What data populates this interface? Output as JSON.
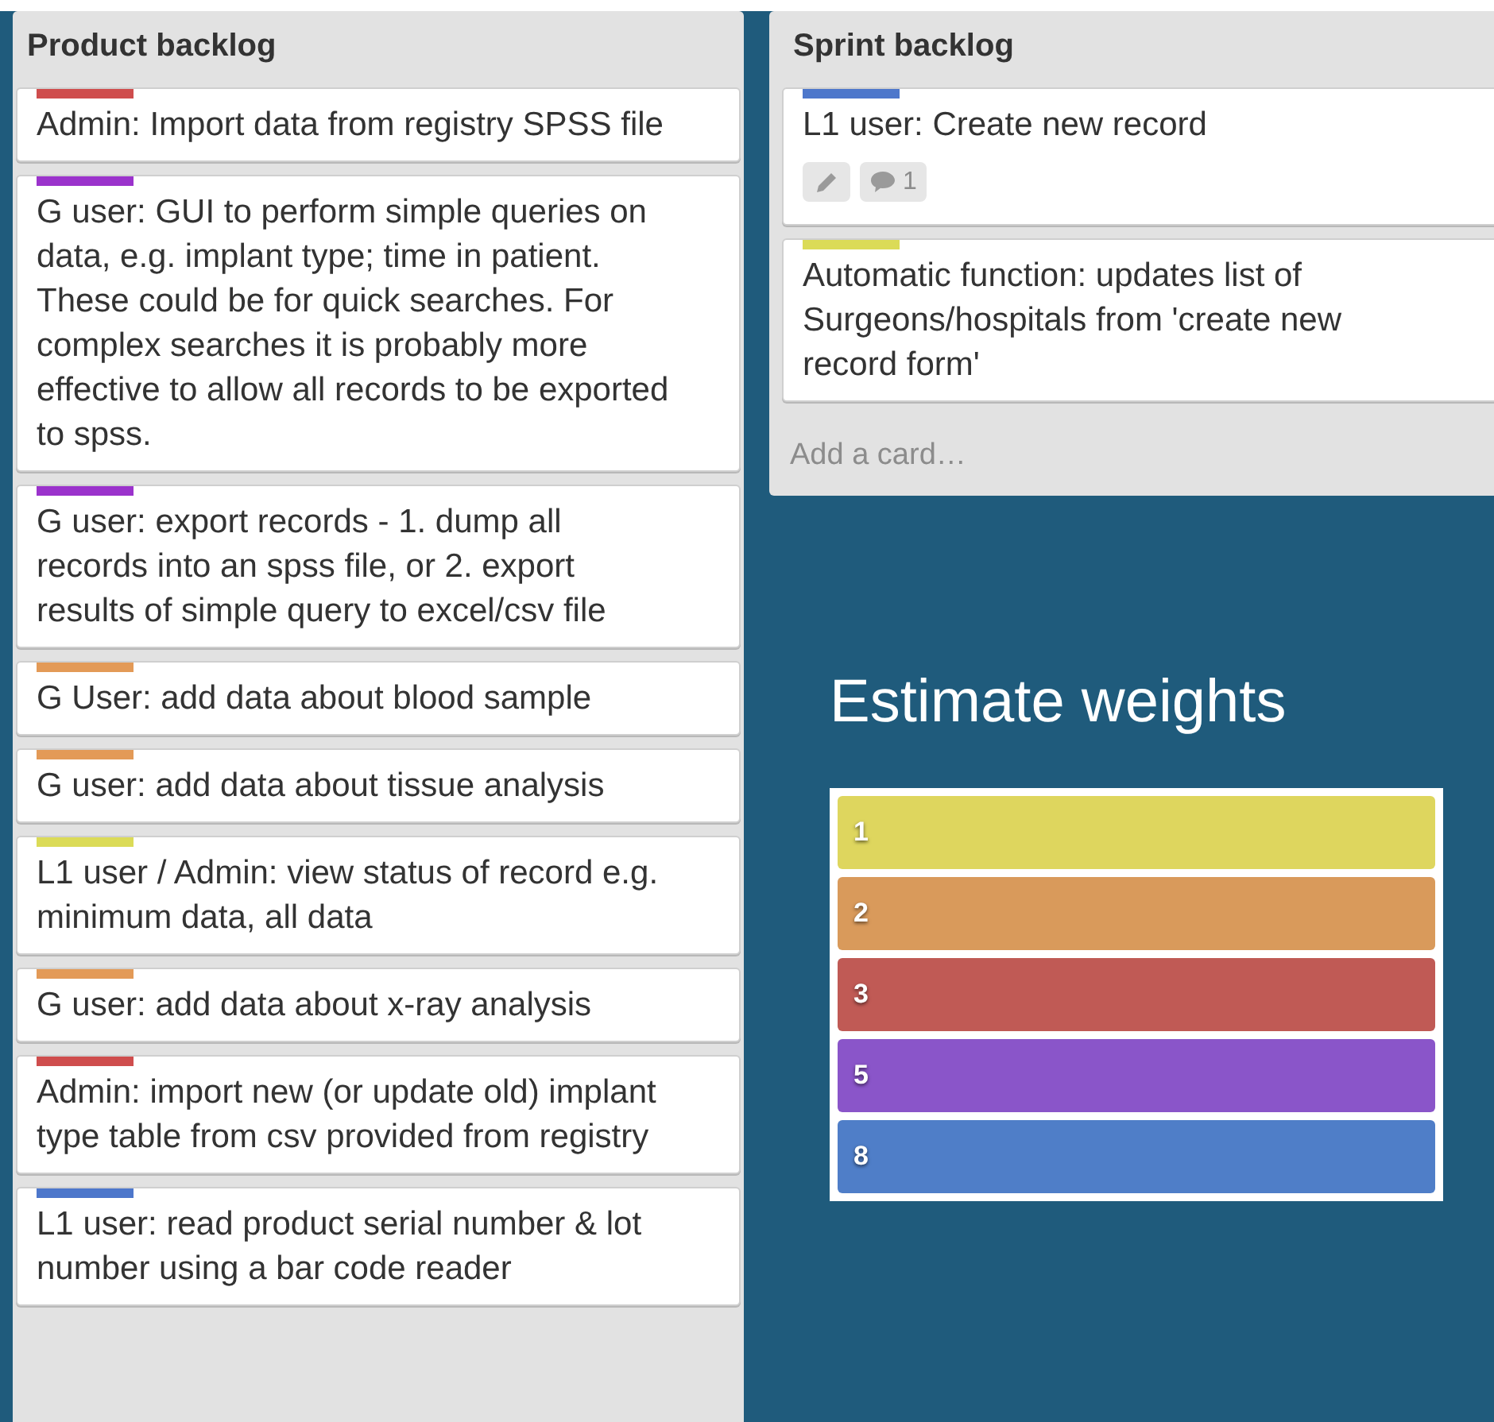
{
  "lists": [
    {
      "title": "Product backlog",
      "cards": [
        {
          "color": "#cf4d4d",
          "text": "Admin: Import data from registry SPSS file"
        },
        {
          "color": "#9b33cc",
          "text": "G user: GUI to perform simple queries on data, e.g. implant type; time in patient. These could be for quick searches. For complex searches it is probably more effective to allow all records to be exported to spss."
        },
        {
          "color": "#9b33cc",
          "text": "G user: export records - 1. dump all records into an spss file, or 2. export results of simple query to excel/csv file"
        },
        {
          "color": "#e39a57",
          "text": "G User: add data about blood sample"
        },
        {
          "color": "#e39a57",
          "text": "G user: add data about tissue analysis"
        },
        {
          "color": "#dbdb57",
          "text": "L1 user / Admin: view status of record e.g. minimum data, all data"
        },
        {
          "color": "#e39a57",
          "text": "G user: add data about x-ray analysis"
        },
        {
          "color": "#cf4d4d",
          "text": "Admin: import new (or update old) implant type table from csv provided from registry"
        },
        {
          "color": "#4d77cb",
          "text": "L1 user: read product serial number & lot number using a bar code reader"
        }
      ]
    },
    {
      "title": "Sprint backlog",
      "cards": [
        {
          "color": "#4d77cb",
          "text": "L1 user: Create new record",
          "badges": [
            {
              "kind": "description"
            },
            {
              "kind": "comments",
              "count": "1"
            }
          ]
        },
        {
          "color": "#dbdb57",
          "text": "Automatic function: updates list of Surgeons/hospitals from 'create new record form'"
        }
      ],
      "add_card": "Add a card…"
    }
  ],
  "legend": {
    "title": "Estimate weights",
    "items": [
      {
        "label": "1",
        "color": "#ded65e"
      },
      {
        "label": "2",
        "color": "#d99a5b"
      },
      {
        "label": "3",
        "color": "#c05a55"
      },
      {
        "label": "5",
        "color": "#8a55c9"
      },
      {
        "label": "8",
        "color": "#4f7ec8"
      }
    ]
  }
}
